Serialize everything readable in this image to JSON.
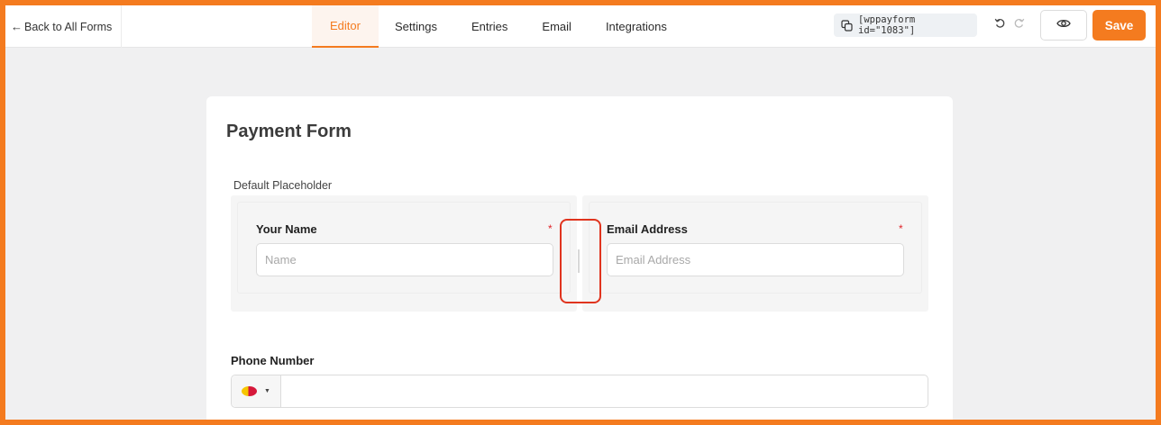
{
  "header": {
    "back_label": "Back to All Forms",
    "tabs": [
      {
        "label": "Editor",
        "active": true
      },
      {
        "label": "Settings",
        "active": false
      },
      {
        "label": "Entries",
        "active": false
      },
      {
        "label": "Email",
        "active": false
      },
      {
        "label": "Integrations",
        "active": false
      }
    ],
    "shortcode": "[wppayform id=\"1083\"]",
    "save_label": "Save",
    "accent_color": "#f47b1f",
    "icons": [
      "arrow-left-icon",
      "copy-icon",
      "undo-icon",
      "redo-icon",
      "eye-icon"
    ]
  },
  "form": {
    "title": "Payment Form",
    "container_label": "Default Placeholder",
    "name_field": {
      "label": "Your Name",
      "required_mark": "*",
      "placeholder": "Name"
    },
    "email_field": {
      "label": "Email Address",
      "required_mark": "*",
      "placeholder": "Email Address"
    },
    "phone_field": {
      "label": "Phone Number",
      "value": ""
    }
  }
}
